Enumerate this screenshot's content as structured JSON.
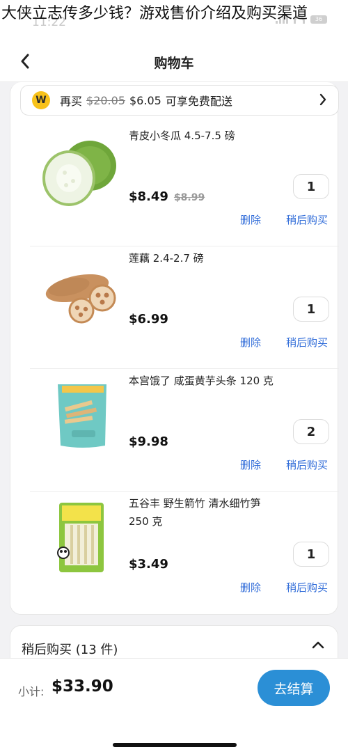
{
  "overlay_title": "大侠立志传多少钱？游戏售价介绍及购买渠道",
  "status": {
    "time": "11:22",
    "battery": "36"
  },
  "nav": {
    "title": "购物车"
  },
  "promo": {
    "badge": "W",
    "prefix": "再买",
    "old_amount": "$20.05",
    "new_amount": "$6.05",
    "suffix": "可享免费配送"
  },
  "items": [
    {
      "name": "青皮小冬瓜 4.5-7.5 磅",
      "price": "$8.49",
      "old_price": "$8.99",
      "qty": "1",
      "delete": "删除",
      "later": "稍后购买"
    },
    {
      "name": "莲藕 2.4-2.7 磅",
      "price": "$6.99",
      "old_price": "",
      "qty": "1",
      "delete": "删除",
      "later": "稍后购买"
    },
    {
      "name": "本宫饿了 咸蛋黄芋头条 120 克",
      "price": "$9.98",
      "old_price": "",
      "qty": "2",
      "delete": "删除",
      "later": "稍后购买"
    },
    {
      "name": "五谷丰 野生箭竹 清水细竹笋 250 克",
      "price": "$3.49",
      "old_price": "",
      "qty": "1",
      "delete": "删除",
      "later": "稍后购买"
    }
  ],
  "save_for_later": {
    "label": "稍后购买 (13 件)"
  },
  "footer": {
    "subtotal_label": "小计:",
    "subtotal_value": "$33.90",
    "checkout_label": "去结算"
  },
  "colors": {
    "accent": "#2b8fd6",
    "link": "#2f6bd8",
    "badge": "#f8c21a"
  }
}
